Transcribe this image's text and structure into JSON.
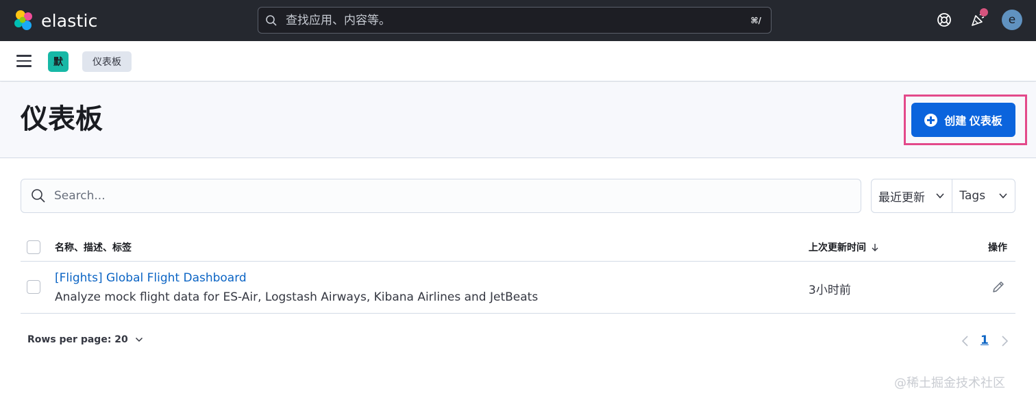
{
  "header": {
    "brand": "elastic",
    "search_placeholder": "查找应用、内容等。",
    "shortcut": "⌘/",
    "icons": [
      "help-icon",
      "news-icon",
      "user-avatar"
    ],
    "avatar_initial": "e"
  },
  "subbar": {
    "space_initial": "默",
    "breadcrumb": "仪表板"
  },
  "page": {
    "title": "仪表板",
    "create_button": "创建 仪表板"
  },
  "search": {
    "placeholder": "Search..."
  },
  "filters": {
    "sort": "最近更新",
    "tags": "Tags"
  },
  "table": {
    "columns": {
      "name": "名称、描述、标签",
      "updated": "上次更新时间",
      "actions": "操作"
    },
    "rows": [
      {
        "title": "[Flights] Global Flight Dashboard",
        "description": "Analyze mock flight data for ES-Air, Logstash Airways, Kibana Airlines and JetBeats",
        "updated": "3小时前"
      }
    ]
  },
  "pagination": {
    "rows_per_page": "Rows per page: 20",
    "current_page": "1"
  },
  "watermark": "@稀土掘金技术社区",
  "colors": {
    "header_bg": "#25282f",
    "primary": "#0b64dd",
    "link": "#0b64c4",
    "space_badge": "#17b8a6",
    "highlight": "#e3498a"
  }
}
